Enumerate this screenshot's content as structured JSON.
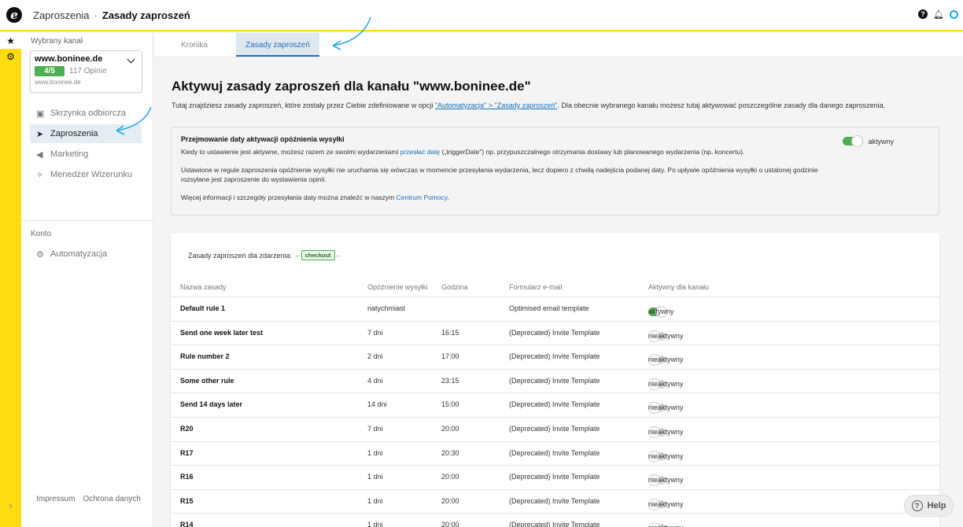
{
  "header": {
    "logo": "e",
    "breadcrumb_parent": "Zaproszenia",
    "breadcrumb_sep": "·",
    "breadcrumb_current": "Zasady zaproszeń",
    "icons": [
      "help-icon",
      "bell-icon",
      "user-icon"
    ]
  },
  "rail": {
    "icons": [
      "star-icon",
      "settings-icon"
    ],
    "expand": "›"
  },
  "sidebar": {
    "channel_label": "Wybrany kanał",
    "channel_name": "www.boninee.de",
    "rating": "4/5",
    "reviews": "117 Opinie",
    "channel_url": "www.boninee.de",
    "items": [
      {
        "label": "Skrzynka odbiorcza",
        "icon": "inbox-icon"
      },
      {
        "label": "Zaproszenia",
        "icon": "send-icon"
      },
      {
        "label": "Marketing",
        "icon": "megaphone-icon"
      },
      {
        "label": "Menedżer Wizerunku",
        "icon": "sparkle-icon"
      }
    ],
    "account_label": "Konto",
    "automation_label": "Automatyzacja",
    "footer_impressum": "Impressum",
    "footer_privacy": "Ochrona danych"
  },
  "tabs": [
    "Kronika",
    "Zasady zaproszeń"
  ],
  "main": {
    "title": "Aktywuj zasady zaproszeń dla kanału \"www.boninee.de\"",
    "desc_before": "Tutaj znajdziesz zasady zaproszeń, które zostały przez Ciebie zdefiniowane w opcji ",
    "desc_link": "\"Automatyzacja\" > \"Zasady zaproszeń\"",
    "desc_after": ". Dla obecnie wybranego kanału możesz tutaj aktywować poszczególne zasady dla danego zaproszenia."
  },
  "info": {
    "title": "Przejmowanie daty aktywacji opóźnienia wysyłki",
    "p1_before": "Kiedy to ustawienie jest aktywne, możesz razem ze swoimi wydarzeniami ",
    "p1_link": "przesłać datę",
    "p1_after": " („triggerDate\") np. przypuszczalnego otrzymania dostawy lub planowanego wydarzenia (np. koncertu).",
    "p2": "Ustawione w regule zaproszenia opóźnienie wysyłki nie uruchamia się wówczas w momencie przesyłania wydarzenia, lecz dopiero z chwilą nadejścia podanej daty. Po upływie opóźnienia wysyłki o ustalonej godzinie rozsyłane jest zaproszenie do wystawienia opinii.",
    "p3_before": "Więcej informacji i szczegóły przesyłania daty można znaleźć w naszym ",
    "p3_link": "Centrum Pomocy",
    "p3_after": ".",
    "toggle_label": "aktywny"
  },
  "rules": {
    "event_label": "Zasady zaproszeń dla zdarzenia:",
    "event_badge": "checkout",
    "headers": [
      "Nazwa zasady",
      "Opóźnienie wysyłki",
      "Godzina",
      "Formularz e-mail",
      "Aktywny dla kanału"
    ],
    "rows": [
      {
        "name": "Default rule 1",
        "delay": "natychmiast",
        "time": "",
        "template": "Optimised email template",
        "status": "aktywny",
        "on": true
      },
      {
        "name": "Send one week later test",
        "delay": "7 dni",
        "time": "16:15",
        "template": "(Deprecated) Invite Template",
        "status": "nieaktywny",
        "on": false
      },
      {
        "name": "Rule number 2",
        "delay": "2 dni",
        "time": "17:00",
        "template": "(Deprecated) Invite Template",
        "status": "nieaktywny",
        "on": false
      },
      {
        "name": "Some other rule",
        "delay": "4 dni",
        "time": "23:15",
        "template": "(Deprecated) Invite Template",
        "status": "nieaktywny",
        "on": false
      },
      {
        "name": "Send 14 days later",
        "delay": "14 dni",
        "time": "15:00",
        "template": "(Deprecated) Invite Template",
        "status": "nieaktywny",
        "on": false
      },
      {
        "name": "R20",
        "delay": "7 dni",
        "time": "20:00",
        "template": "(Deprecated) Invite Template",
        "status": "nieaktywny",
        "on": false
      },
      {
        "name": "R17",
        "delay": "1 dni",
        "time": "20:30",
        "template": "(Deprecated) Invite Template",
        "status": "nieaktywny",
        "on": false
      },
      {
        "name": "R16",
        "delay": "1 dni",
        "time": "20:00",
        "template": "(Deprecated) Invite Template",
        "status": "nieaktywny",
        "on": false
      },
      {
        "name": "R15",
        "delay": "1 dni",
        "time": "20:00",
        "template": "(Deprecated) Invite Template",
        "status": "nieaktywny",
        "on": false
      },
      {
        "name": "R14",
        "delay": "1 dni",
        "time": "20:00",
        "template": "(Deprecated) Invite Template",
        "status": "nieaktywny",
        "on": false
      }
    ]
  },
  "help_label": "Help",
  "colors": {
    "accent_yellow": "#ffdc0f",
    "active_green": "#4caf50",
    "link_blue": "#1a6fb5",
    "annotation_blue": "#2aa7e0"
  }
}
